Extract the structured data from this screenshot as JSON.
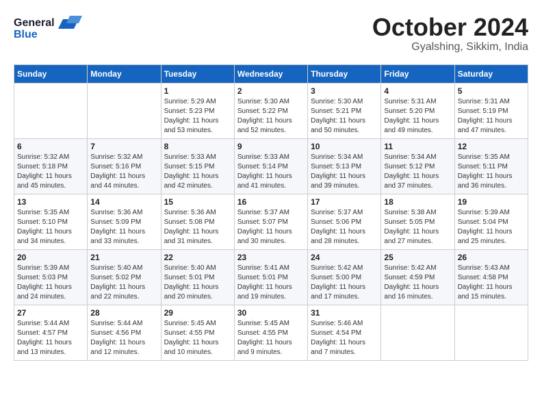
{
  "logo": {
    "general": "General",
    "blue": "Blue"
  },
  "header": {
    "month": "October 2024",
    "location": "Gyalshing, Sikkim, India"
  },
  "weekdays": [
    "Sunday",
    "Monday",
    "Tuesday",
    "Wednesday",
    "Thursday",
    "Friday",
    "Saturday"
  ],
  "weeks": [
    [
      {
        "day": "",
        "sunrise": "",
        "sunset": "",
        "daylight": ""
      },
      {
        "day": "",
        "sunrise": "",
        "sunset": "",
        "daylight": ""
      },
      {
        "day": "1",
        "sunrise": "Sunrise: 5:29 AM",
        "sunset": "Sunset: 5:23 PM",
        "daylight": "Daylight: 11 hours and 53 minutes."
      },
      {
        "day": "2",
        "sunrise": "Sunrise: 5:30 AM",
        "sunset": "Sunset: 5:22 PM",
        "daylight": "Daylight: 11 hours and 52 minutes."
      },
      {
        "day": "3",
        "sunrise": "Sunrise: 5:30 AM",
        "sunset": "Sunset: 5:21 PM",
        "daylight": "Daylight: 11 hours and 50 minutes."
      },
      {
        "day": "4",
        "sunrise": "Sunrise: 5:31 AM",
        "sunset": "Sunset: 5:20 PM",
        "daylight": "Daylight: 11 hours and 49 minutes."
      },
      {
        "day": "5",
        "sunrise": "Sunrise: 5:31 AM",
        "sunset": "Sunset: 5:19 PM",
        "daylight": "Daylight: 11 hours and 47 minutes."
      }
    ],
    [
      {
        "day": "6",
        "sunrise": "Sunrise: 5:32 AM",
        "sunset": "Sunset: 5:18 PM",
        "daylight": "Daylight: 11 hours and 45 minutes."
      },
      {
        "day": "7",
        "sunrise": "Sunrise: 5:32 AM",
        "sunset": "Sunset: 5:16 PM",
        "daylight": "Daylight: 11 hours and 44 minutes."
      },
      {
        "day": "8",
        "sunrise": "Sunrise: 5:33 AM",
        "sunset": "Sunset: 5:15 PM",
        "daylight": "Daylight: 11 hours and 42 minutes."
      },
      {
        "day": "9",
        "sunrise": "Sunrise: 5:33 AM",
        "sunset": "Sunset: 5:14 PM",
        "daylight": "Daylight: 11 hours and 41 minutes."
      },
      {
        "day": "10",
        "sunrise": "Sunrise: 5:34 AM",
        "sunset": "Sunset: 5:13 PM",
        "daylight": "Daylight: 11 hours and 39 minutes."
      },
      {
        "day": "11",
        "sunrise": "Sunrise: 5:34 AM",
        "sunset": "Sunset: 5:12 PM",
        "daylight": "Daylight: 11 hours and 37 minutes."
      },
      {
        "day": "12",
        "sunrise": "Sunrise: 5:35 AM",
        "sunset": "Sunset: 5:11 PM",
        "daylight": "Daylight: 11 hours and 36 minutes."
      }
    ],
    [
      {
        "day": "13",
        "sunrise": "Sunrise: 5:35 AM",
        "sunset": "Sunset: 5:10 PM",
        "daylight": "Daylight: 11 hours and 34 minutes."
      },
      {
        "day": "14",
        "sunrise": "Sunrise: 5:36 AM",
        "sunset": "Sunset: 5:09 PM",
        "daylight": "Daylight: 11 hours and 33 minutes."
      },
      {
        "day": "15",
        "sunrise": "Sunrise: 5:36 AM",
        "sunset": "Sunset: 5:08 PM",
        "daylight": "Daylight: 11 hours and 31 minutes."
      },
      {
        "day": "16",
        "sunrise": "Sunrise: 5:37 AM",
        "sunset": "Sunset: 5:07 PM",
        "daylight": "Daylight: 11 hours and 30 minutes."
      },
      {
        "day": "17",
        "sunrise": "Sunrise: 5:37 AM",
        "sunset": "Sunset: 5:06 PM",
        "daylight": "Daylight: 11 hours and 28 minutes."
      },
      {
        "day": "18",
        "sunrise": "Sunrise: 5:38 AM",
        "sunset": "Sunset: 5:05 PM",
        "daylight": "Daylight: 11 hours and 27 minutes."
      },
      {
        "day": "19",
        "sunrise": "Sunrise: 5:39 AM",
        "sunset": "Sunset: 5:04 PM",
        "daylight": "Daylight: 11 hours and 25 minutes."
      }
    ],
    [
      {
        "day": "20",
        "sunrise": "Sunrise: 5:39 AM",
        "sunset": "Sunset: 5:03 PM",
        "daylight": "Daylight: 11 hours and 24 minutes."
      },
      {
        "day": "21",
        "sunrise": "Sunrise: 5:40 AM",
        "sunset": "Sunset: 5:02 PM",
        "daylight": "Daylight: 11 hours and 22 minutes."
      },
      {
        "day": "22",
        "sunrise": "Sunrise: 5:40 AM",
        "sunset": "Sunset: 5:01 PM",
        "daylight": "Daylight: 11 hours and 20 minutes."
      },
      {
        "day": "23",
        "sunrise": "Sunrise: 5:41 AM",
        "sunset": "Sunset: 5:01 PM",
        "daylight": "Daylight: 11 hours and 19 minutes."
      },
      {
        "day": "24",
        "sunrise": "Sunrise: 5:42 AM",
        "sunset": "Sunset: 5:00 PM",
        "daylight": "Daylight: 11 hours and 17 minutes."
      },
      {
        "day": "25",
        "sunrise": "Sunrise: 5:42 AM",
        "sunset": "Sunset: 4:59 PM",
        "daylight": "Daylight: 11 hours and 16 minutes."
      },
      {
        "day": "26",
        "sunrise": "Sunrise: 5:43 AM",
        "sunset": "Sunset: 4:58 PM",
        "daylight": "Daylight: 11 hours and 15 minutes."
      }
    ],
    [
      {
        "day": "27",
        "sunrise": "Sunrise: 5:44 AM",
        "sunset": "Sunset: 4:57 PM",
        "daylight": "Daylight: 11 hours and 13 minutes."
      },
      {
        "day": "28",
        "sunrise": "Sunrise: 5:44 AM",
        "sunset": "Sunset: 4:56 PM",
        "daylight": "Daylight: 11 hours and 12 minutes."
      },
      {
        "day": "29",
        "sunrise": "Sunrise: 5:45 AM",
        "sunset": "Sunset: 4:55 PM",
        "daylight": "Daylight: 11 hours and 10 minutes."
      },
      {
        "day": "30",
        "sunrise": "Sunrise: 5:45 AM",
        "sunset": "Sunset: 4:55 PM",
        "daylight": "Daylight: 11 hours and 9 minutes."
      },
      {
        "day": "31",
        "sunrise": "Sunrise: 5:46 AM",
        "sunset": "Sunset: 4:54 PM",
        "daylight": "Daylight: 11 hours and 7 minutes."
      },
      {
        "day": "",
        "sunrise": "",
        "sunset": "",
        "daylight": ""
      },
      {
        "day": "",
        "sunrise": "",
        "sunset": "",
        "daylight": ""
      }
    ]
  ]
}
